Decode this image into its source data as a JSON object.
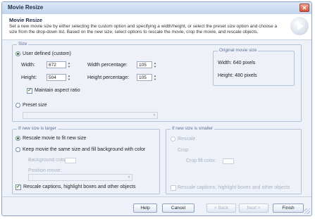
{
  "window": {
    "title": "Movie Resize",
    "close_glyph": "✕"
  },
  "header": {
    "title": "Movie Resize",
    "description": "Set a new movie size by either selecting the custom option and specifying a width/height, or select the preset size option and choose a size from the drop-down list. Based on the new size, select options to rescale the movie, crop the movie, and rescale objects.",
    "logo_icon": "play-logo-icon"
  },
  "size": {
    "legend": "Size",
    "user_defined": {
      "label": "User defined (custom)",
      "selected": true
    },
    "width": {
      "label": "Width:",
      "value": "672"
    },
    "height": {
      "label": "Height:",
      "value": "504"
    },
    "width_percentage": {
      "label": "Width percentage:",
      "value": "105"
    },
    "height_percentage": {
      "label": "Height percentage:",
      "value": "105"
    },
    "maintain_aspect": {
      "label": "Maintain aspect ratio",
      "checked": true
    },
    "preset": {
      "label": "Preset size",
      "selected": false
    },
    "original": {
      "legend": "Original movie size",
      "width": "Width: 640 pixels",
      "height": "Height: 480 pixels"
    }
  },
  "larger": {
    "legend": "If new size is larger",
    "rescale_fit": {
      "label": "Rescale movie to fit new size",
      "selected": true
    },
    "keep_same": {
      "label": "Keep movie the same size and fill background with color",
      "selected": false
    },
    "background_color": {
      "label": "Background color:"
    },
    "position": {
      "label": "Position movie:"
    },
    "rescale_captions": {
      "label": "Rescale captions, highlight boxes and other objects",
      "checked": true
    }
  },
  "smaller": {
    "legend": "If new size is smaller",
    "rescale": {
      "label": "Rescale"
    },
    "crop": {
      "label": "Crop"
    },
    "crop_color": {
      "label": "Crop fill color:"
    },
    "rescale_captions": {
      "label": "Rescale captions, highlight boxes and other objects",
      "checked": false
    }
  },
  "buttons": {
    "help": "Help",
    "cancel": "Cancel",
    "back": "< Back",
    "next": "Next >",
    "finish": "Finish"
  },
  "colors": {
    "accent": "#5a6f9a",
    "check_green": "#2a8a1a",
    "close_red": "#d2553a"
  }
}
